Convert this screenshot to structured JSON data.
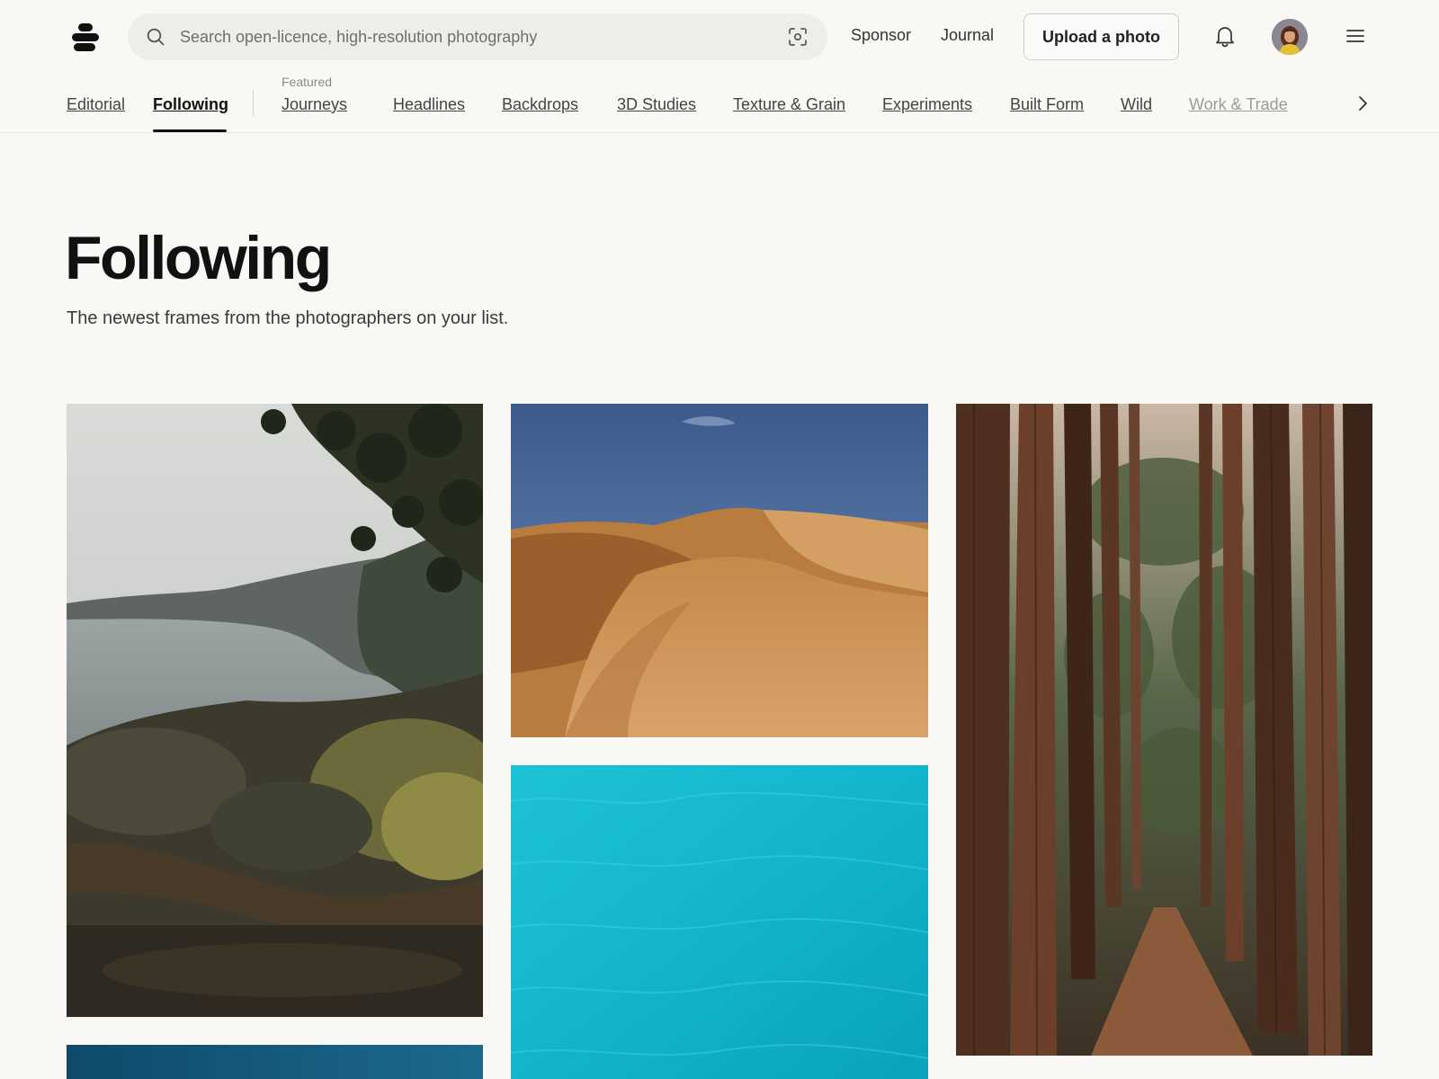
{
  "header": {
    "logo_name": "site-logo",
    "search": {
      "placeholder": "Search open-licence, high-resolution photography"
    },
    "nav": {
      "sponsor": "Sponsor",
      "journal": "Journal"
    },
    "upload_label": "Upload a photo"
  },
  "tabs": {
    "editorial": "Editorial",
    "following": "Following",
    "featured_label": "Featured",
    "items": [
      "Journeys",
      "Headlines",
      "Backdrops",
      "3D Studies",
      "Texture & Grain",
      "Experiments",
      "Built Form",
      "Wild",
      "Work & Trade"
    ],
    "active": "Following"
  },
  "hero": {
    "title": "Following",
    "subtitle": "The newest frames from the photographers on your list."
  },
  "colors": {
    "page_bg": "#f9f8f5",
    "text_primary": "#111111",
    "search_bg": "#efede8"
  }
}
